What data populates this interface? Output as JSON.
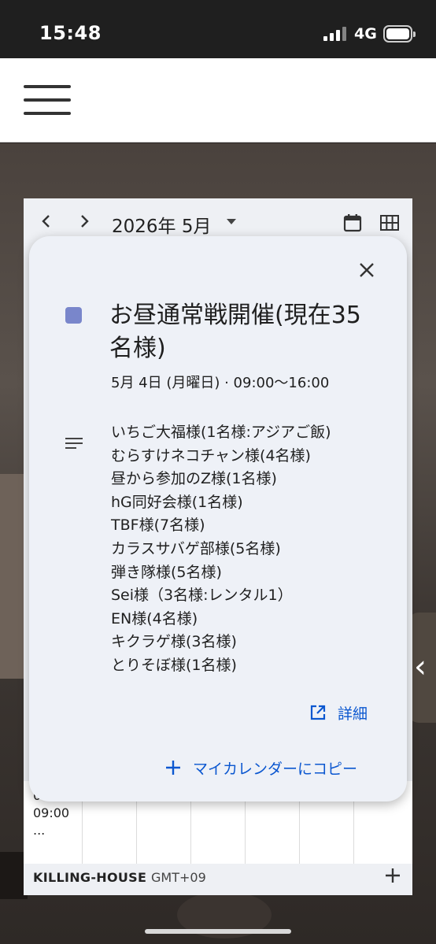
{
  "status_bar": {
    "time": "15:48",
    "network": "4G",
    "battery_level": 1.0
  },
  "calendar": {
    "month_label": "2026年 5月",
    "prev_icon": "chevron-left-icon",
    "next_icon": "chevron-right-icon",
    "dropdown_icon": "caret-down-icon",
    "today_icon": "calendar-icon",
    "view_icon": "grid-view-icon",
    "grid_event_lines": [
      "01:0",
      "09:00",
      "..."
    ],
    "footer_name": "KILLING-HOUSE",
    "footer_tz": "GMT+09",
    "footer_add_icon": "plus-icon"
  },
  "popup": {
    "color": "#7986cb",
    "title": "お昼通常戦開催(現在35名様)",
    "date_text": "5月 4日 (月曜日)  ·  09:00〜16:00",
    "description_icon": "notes-icon",
    "description_lines": [
      "いちご大福様(1名様:アジアご飯)",
      "むらすけネコチャン様(4名様)",
      "昼から参加のZ様(1名様)",
      "hG同好会様(1名様)",
      "TBF様(7名様)",
      "カラスサバゲ部様(5名様)",
      "弾き隊様(5名様)",
      "Sei様（3名様:レンタル1）",
      "EN様(4名様)",
      "キクラゲ様(3名様)",
      "とりそぼ様(1名様)"
    ],
    "detail_label": "詳細",
    "detail_icon": "open-in-new-icon",
    "copy_label": "マイカレンダーにコピー",
    "copy_icon": "plus-icon",
    "close_icon": "close-icon"
  },
  "colors": {
    "accent_blue": "#0b57d0",
    "event_color": "#7986cb"
  }
}
